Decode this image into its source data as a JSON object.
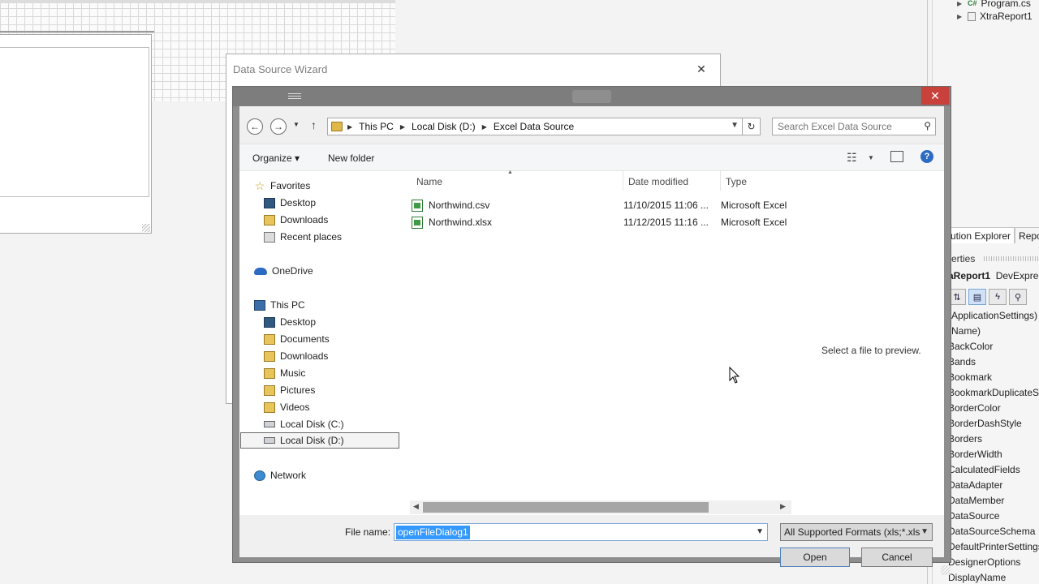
{
  "ide": {
    "solution_tree": [
      {
        "label": "Program.cs",
        "badge": "C#"
      },
      {
        "label": "XtraReport1"
      }
    ],
    "panel_tabs": [
      "ution Explorer",
      "Repo"
    ],
    "properties_title": "erties",
    "properties_object": {
      "name": "aReport1",
      "type": "DevExpre"
    },
    "properties_list": [
      "(ApplicationSettings)",
      "(Name)",
      "BackColor",
      "Bands",
      "Bookmark",
      "BookmarkDuplicateSu",
      "BorderColor",
      "BorderDashStyle",
      "Borders",
      "BorderWidth",
      "CalculatedFields",
      "DataAdapter",
      "DataMember",
      "DataSource",
      "DataSourceSchema",
      "DefaultPrinterSettings",
      "DesignerOptions",
      "DisplayName"
    ]
  },
  "wizard": {
    "title": "Data Source Wizard",
    "close_glyph": "✕"
  },
  "dialog": {
    "close_glyph": "✕",
    "breadcrumbs": [
      "This PC",
      "Local Disk (D:)",
      "Excel Data Source"
    ],
    "search_placeholder": "Search Excel Data Source",
    "toolbar": {
      "organize": "Organize ▾",
      "new_folder": "New folder"
    },
    "nav": {
      "favorites": "Favorites",
      "favorites_items": [
        "Desktop",
        "Downloads",
        "Recent places"
      ],
      "onedrive": "OneDrive",
      "this_pc": "This PC",
      "this_pc_items": [
        "Desktop",
        "Documents",
        "Downloads",
        "Music",
        "Pictures",
        "Videos",
        "Local Disk (C:)",
        "Local Disk (D:)"
      ],
      "network": "Network",
      "selected": "Local Disk (D:)"
    },
    "columns": {
      "name": "Name",
      "date_modified": "Date modified",
      "type": "Type"
    },
    "files": [
      {
        "name": "Northwind.csv",
        "date": "11/10/2015 11:06 ...",
        "type": "Microsoft Excel"
      },
      {
        "name": "Northwind.xlsx",
        "date": "11/12/2015 11:16 ...",
        "type": "Microsoft Excel"
      }
    ],
    "preview_message": "Select a file to preview.",
    "file_name_label": "File name:",
    "file_name_value": "openFileDialog1",
    "file_type_value": "All Supported Formats (xls;*.xls",
    "open_button": "Open",
    "cancel_button": "Cancel"
  },
  "colors": {
    "dialog_frame": "#8e8e8e",
    "close_red": "#c9413b",
    "selection_blue": "#3399ff",
    "help_blue": "#2c6bc2"
  }
}
